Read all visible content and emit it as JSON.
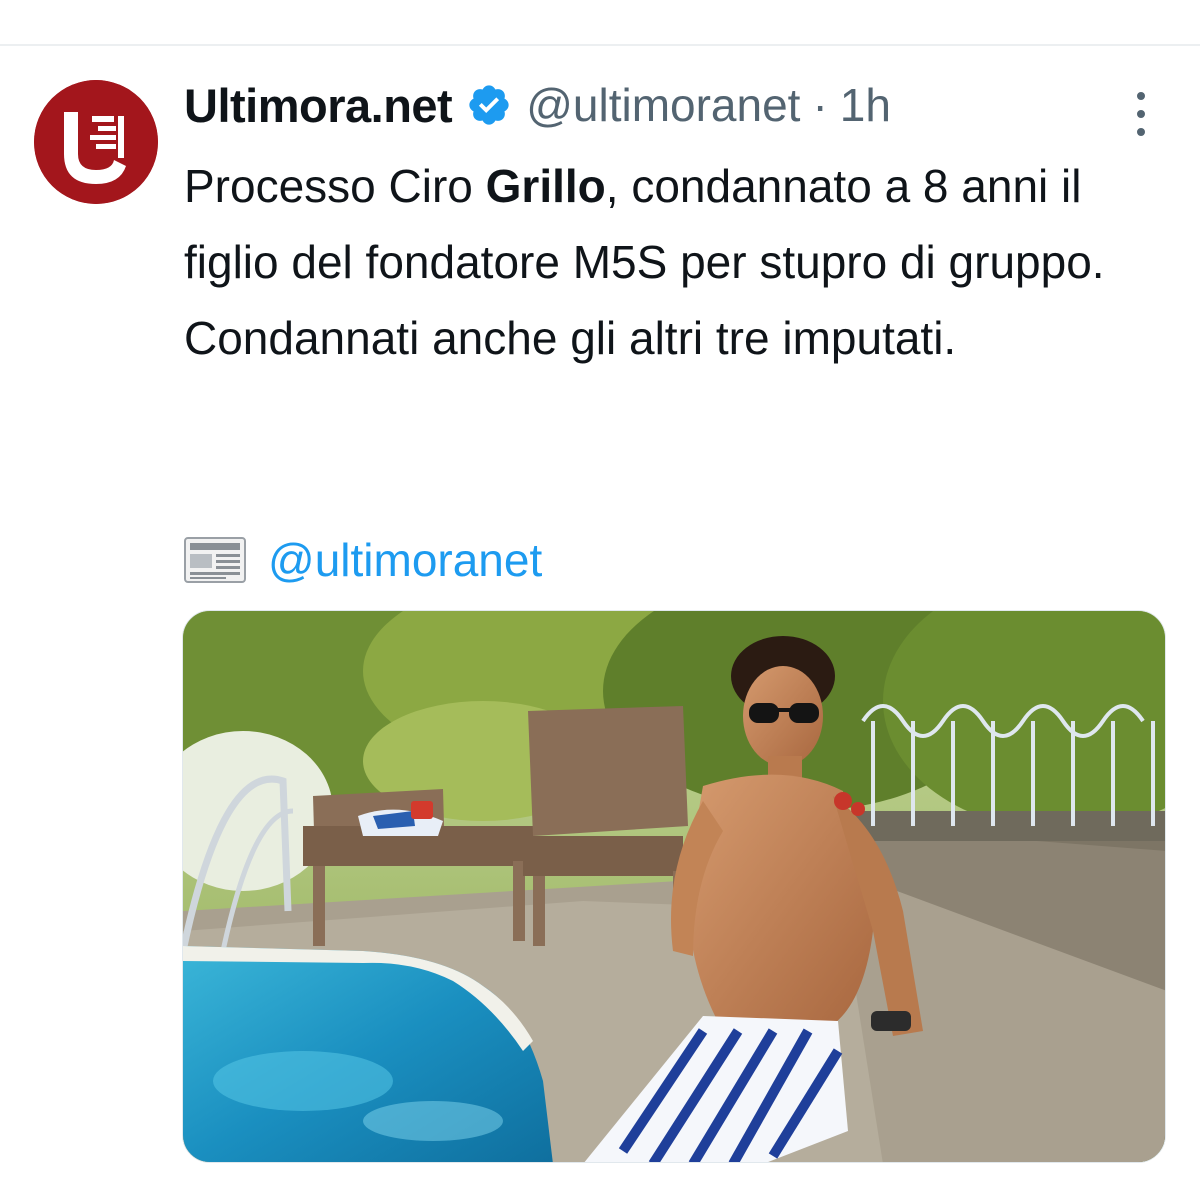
{
  "tweet": {
    "display_name": "Ultimora.net",
    "handle": "@ultimoranet",
    "separator": "·",
    "time": "1h",
    "text_part1": "Processo Ciro ",
    "text_bold": "Grillo",
    "text_part2": ", condannato a 8 anni il figlio del fondatore M5S per stupro di gruppo. Condannati anche gli altri tre imputati.",
    "source_mention": "@ultimoranet"
  },
  "icons": {
    "avatar": "ultimora-logo-icon",
    "verified": "verified-badge-icon",
    "more": "more-options-icon",
    "newspaper": "newspaper-emoji-icon"
  },
  "colors": {
    "text_primary": "#0f1419",
    "text_secondary": "#536471",
    "link": "#1d9bf0",
    "verified": "#1d9bf0",
    "avatar_bg": "#a3161c"
  }
}
